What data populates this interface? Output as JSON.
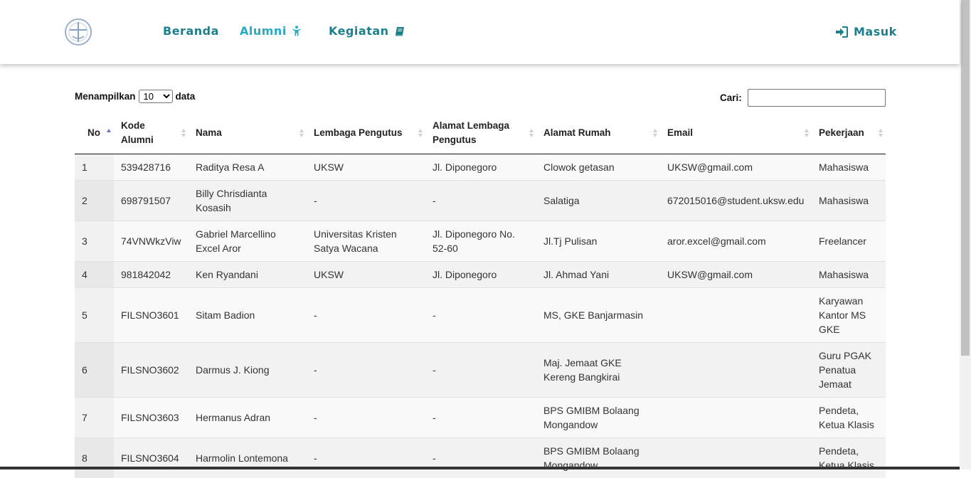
{
  "nav": {
    "logo_name": "church-logo",
    "items": [
      {
        "label": "Beranda",
        "icon": ""
      },
      {
        "label": "Alumni",
        "icon": "person-icon"
      },
      {
        "label": "Kegiatan",
        "icon": "book-icon"
      }
    ],
    "login_label": "Masuk",
    "login_icon": "sign-in-icon",
    "color": "#1e7f8c",
    "active_color": "#29a9c6"
  },
  "controls": {
    "length_prefix": "Menampilkan",
    "length_value": "10",
    "length_suffix": "data",
    "search_label": "Cari:",
    "search_value": ""
  },
  "table": {
    "columns": [
      "No",
      "Kode Alumni",
      "Nama",
      "Lembaga Pengutus",
      "Alamat Lembaga Pengutus",
      "Alamat Rumah",
      "Email",
      "Pekerjaan"
    ],
    "sorted_column": "No",
    "sort_direction": "ascending",
    "rows": [
      [
        "1",
        "539428716",
        "Raditya Resa A",
        "UKSW",
        "Jl. Diponegoro",
        "Clowok getasan",
        "UKSW@gmail.com",
        "Mahasiswa"
      ],
      [
        "2",
        "698791507",
        "Billy Chrisdianta Kosasih",
        "-",
        "-",
        "Salatiga",
        "672015016@student.uksw.edu",
        "Mahasiswa"
      ],
      [
        "3",
        "74VNWkzViw",
        "Gabriel Marcellino Excel Aror",
        "Universitas Kristen Satya Wacana",
        "Jl. Diponegoro No. 52-60",
        "Jl.Tj Pulisan",
        "aror.excel@gmail.com",
        "Freelancer"
      ],
      [
        "4",
        "981842042",
        "Ken Ryandani",
        "UKSW",
        "Jl. Diponegoro",
        "Jl. Ahmad Yani",
        "UKSW@gmail.com",
        "Mahasiswa"
      ],
      [
        "5",
        "FILSNO3601",
        "Sitam Badion",
        "-",
        "-",
        "MS, GKE Banjarmasin",
        "",
        "Karyawan Kantor MS GKE"
      ],
      [
        "6",
        "FILSNO3602",
        "Darmus J. Kiong",
        "-",
        "-",
        "Maj. Jemaat GKE Kereng Bangkirai",
        "",
        "Guru PGAK Penatua Jemaat"
      ],
      [
        "7",
        "FILSNO3603",
        "Hermanus Adran",
        "-",
        "-",
        "BPS GMIBM Bolaang Mongandow",
        "",
        "Pendeta, Ketua Klasis"
      ],
      [
        "8",
        "FILSNO3604",
        "Harmolin Lontemona",
        "-",
        "-",
        "BPS GMIBM Bolaang Mongandow",
        "",
        "Pendeta, Ketua Klasis"
      ]
    ]
  }
}
